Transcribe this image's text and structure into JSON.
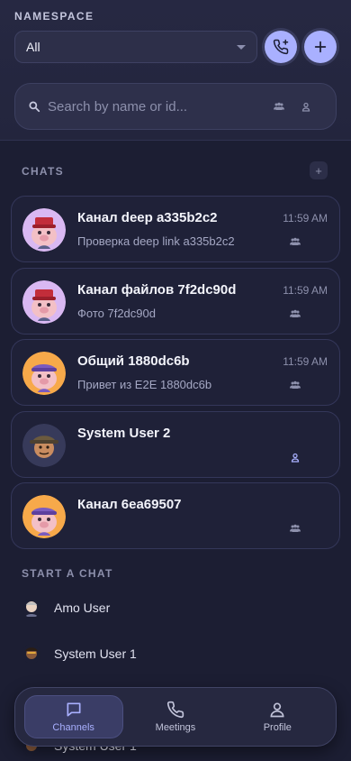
{
  "namespace": {
    "label": "NAMESPACE",
    "selected": "All"
  },
  "search": {
    "placeholder": "Search by name or id..."
  },
  "chats_section": {
    "label": "CHATS",
    "add_label": "+"
  },
  "chats": [
    {
      "title": "Канал deep a335b2c2",
      "subtitle": "Проверка deep link a335b2c2",
      "time": "11:59 AM",
      "kind": "group-icon",
      "avatar": "pig-red-hat"
    },
    {
      "title": "Канал файлов 7f2dc90d",
      "subtitle": "Фото 7f2dc90d",
      "time": "11:59 AM",
      "kind": "group-icon",
      "avatar": "pig-red-hat"
    },
    {
      "title": "Общий 1880dc6b",
      "subtitle": "Привет из E2E 1880dc6b",
      "time": "11:59 AM",
      "kind": "group-icon",
      "avatar": "pig-purple-hat"
    },
    {
      "title": "System User 2",
      "subtitle": "",
      "time": "",
      "kind": "user-icon",
      "avatar": "man-hat"
    },
    {
      "title": "Канал 6ea69507",
      "subtitle": "",
      "time": "",
      "kind": "group-icon",
      "avatar": "pig-purple-hat"
    }
  ],
  "start_section": {
    "label": "START A CHAT"
  },
  "people": [
    {
      "name": "Amo User"
    },
    {
      "name": "System User 1"
    },
    {
      "name": "System User 1"
    }
  ],
  "nav": {
    "items": [
      {
        "label": "Channels",
        "icon": "chat-bubble-icon",
        "active": true
      },
      {
        "label": "Meetings",
        "icon": "phone-icon",
        "active": false
      },
      {
        "label": "Profile",
        "icon": "person-icon",
        "active": false
      }
    ]
  },
  "colors": {
    "accent": "#a9b0ff",
    "background": "#1c1e33",
    "card": "#1f2138"
  }
}
